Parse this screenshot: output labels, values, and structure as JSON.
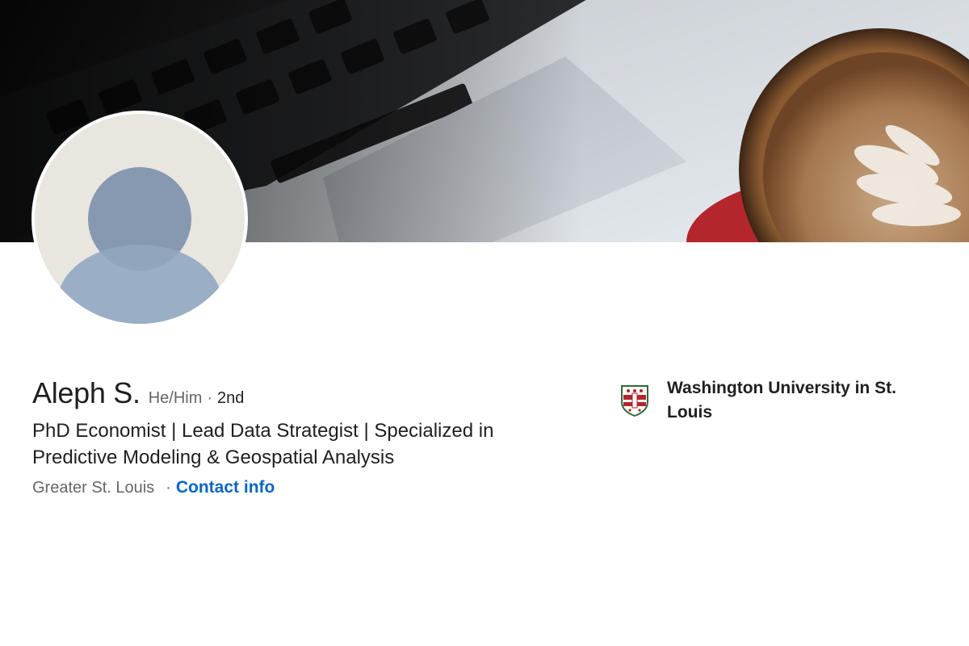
{
  "profile": {
    "name": "Aleph S.",
    "pronouns": "He/Him",
    "separator": "·",
    "connection_degree": "2nd",
    "headline": "PhD Economist | Lead Data Strategist | Specialized in Predictive Modeling & Geospatial Analysis",
    "location": "Greater St. Louis",
    "location_separator": "·",
    "contact_link": "Contact info"
  },
  "education": {
    "school": "Washington University in St. Louis",
    "logo_icon": "university-shield-icon"
  },
  "banner": {
    "image": "laptop-and-latte-banner"
  },
  "avatar": {
    "icon": "default-person-avatar-icon"
  },
  "colors": {
    "link": "#0a66c2",
    "text_primary": "#1f1f1f",
    "text_secondary": "#666666",
    "avatar_bg": "#e9e5df",
    "avatar_figure": "#9aafc6"
  }
}
